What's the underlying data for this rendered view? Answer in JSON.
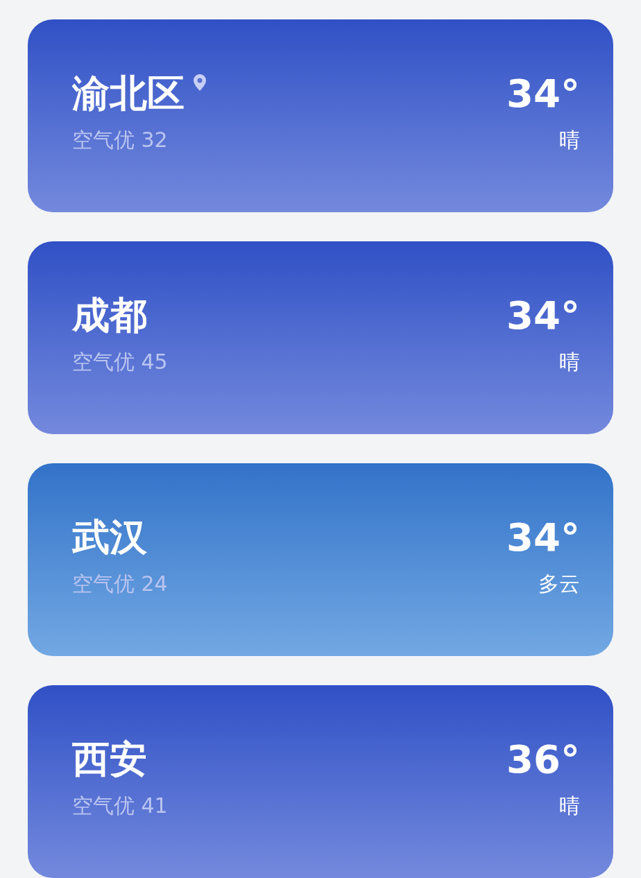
{
  "cities": [
    {
      "name": "渝北区",
      "current_location": true,
      "air_quality": "空气优 32",
      "temperature": "34°",
      "condition": "晴",
      "kind": "clear"
    },
    {
      "name": "成都",
      "current_location": false,
      "air_quality": "空气优 45",
      "temperature": "34°",
      "condition": "晴",
      "kind": "clear"
    },
    {
      "name": "武汉",
      "current_location": false,
      "air_quality": "空气优 24",
      "temperature": "34°",
      "condition": "多云",
      "kind": "cloudy"
    },
    {
      "name": "西安",
      "current_location": false,
      "air_quality": "空气优 41",
      "temperature": "36°",
      "condition": "晴",
      "kind": "clear"
    }
  ]
}
